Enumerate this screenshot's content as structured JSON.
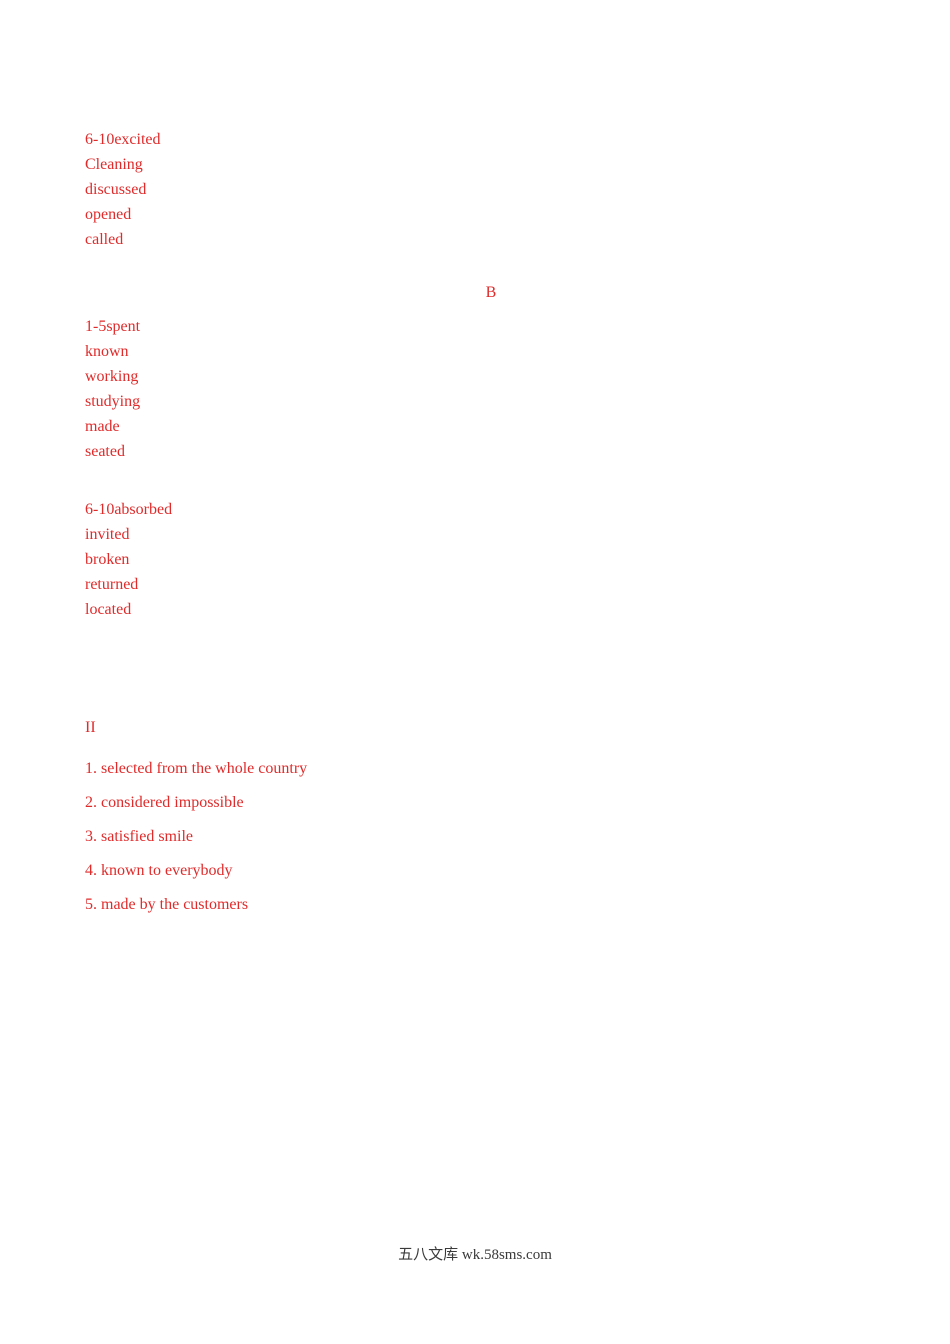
{
  "document": {
    "answer_blocks": [
      {
        "id": "block-a",
        "lines": [
          "6-10excited",
          "Cleaning",
          "discussed",
          "opened",
          "called"
        ]
      },
      {
        "id": "block-b1",
        "lines": [
          "1-5spent",
          "known",
          "working",
          "studying",
          "made",
          "seated"
        ]
      },
      {
        "id": "block-b2",
        "lines": [
          "6-10absorbed",
          "invited",
          "broken",
          "returned",
          "located"
        ]
      }
    ],
    "section_letter": "B",
    "roman_heading": "II",
    "numbered_items": [
      "1. selected from the whole country",
      "2. considered impossible",
      "3. satisfied smile",
      "4. known to everybody",
      "5. made by the customers"
    ],
    "footer": "五八文库 wk.58sms.com",
    "colors": {
      "text_red": "#e02b2b",
      "footer_gray": "#3a3a3a",
      "background": "#ffffff"
    }
  }
}
